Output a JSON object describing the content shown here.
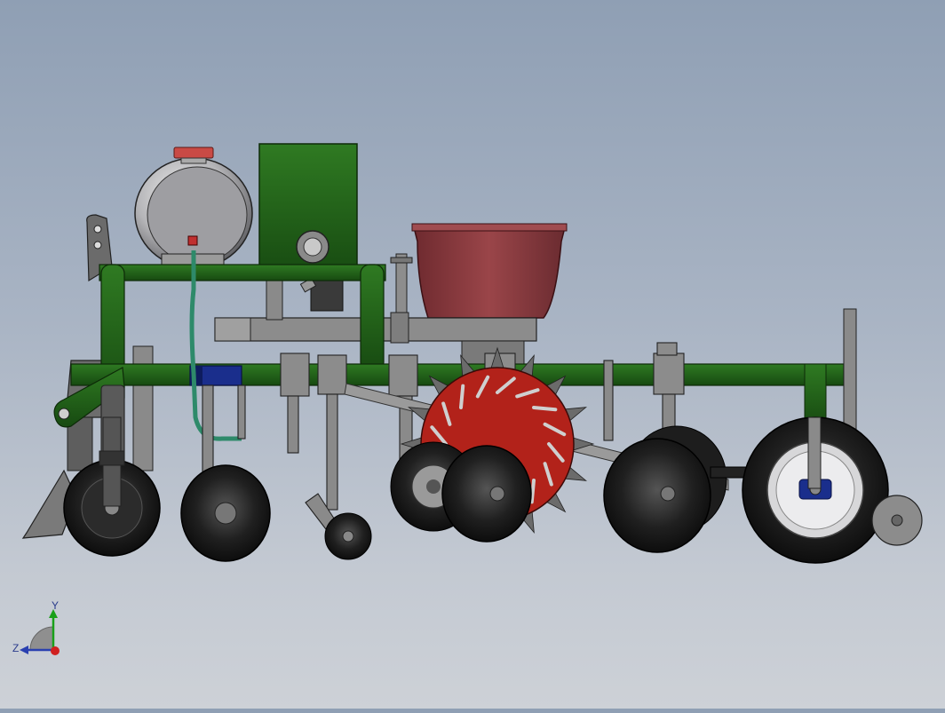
{
  "scene": {
    "title": "",
    "colors": {
      "background_top": "#8f9fb4",
      "background_bottom": "#cdd1d7",
      "frame_green": "#1f5e17",
      "hopper_red": "#8a3a3e",
      "wheel_red": "#b2221a",
      "tire_black": "#1a1a1a",
      "steel_gray": "#8c8c8c",
      "tank_silver": "#b9b9bb",
      "hose_green": "#2e8a6a",
      "motor_blue": "#1a2e8c"
    }
  },
  "triad": {
    "y_label": "Y",
    "z_label": "Z",
    "icon": "coordinate-triad-icon"
  }
}
